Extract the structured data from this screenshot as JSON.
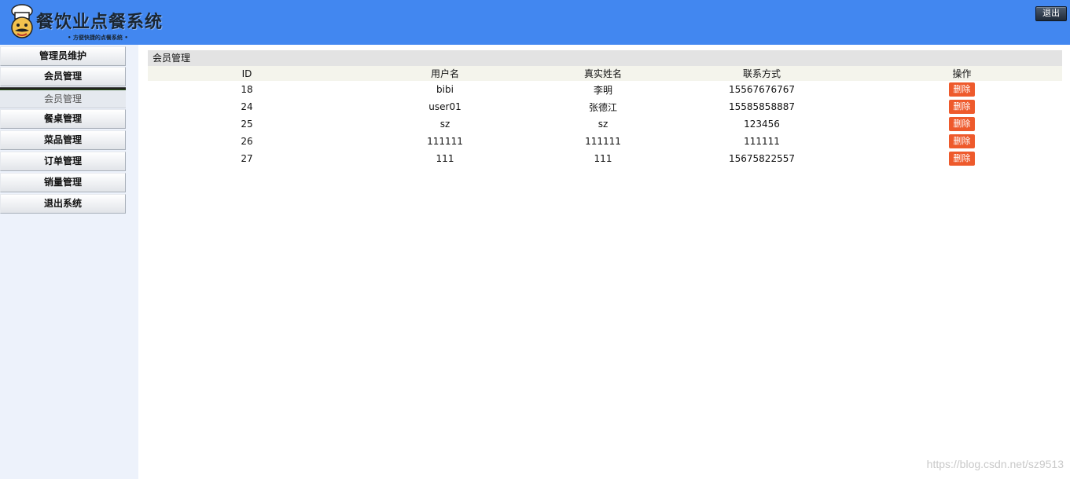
{
  "header": {
    "title": "餐饮业点餐系统",
    "slogan": "• 方便快捷的点餐系统 •",
    "logout_label": "退出",
    "background": "#4287f0"
  },
  "sidebar": {
    "menus": [
      {
        "label": "管理员维护"
      },
      {
        "label": "会员管理"
      },
      {
        "label": "餐桌管理"
      },
      {
        "label": "菜品管理"
      },
      {
        "label": "订单管理"
      },
      {
        "label": "销量管理"
      },
      {
        "label": "退出系统"
      }
    ],
    "submenu": {
      "label": "会员管理"
    }
  },
  "main": {
    "panel_title": "会员管理",
    "columns": [
      "ID",
      "用户名",
      "真实姓名",
      "联系方式",
      "操作"
    ],
    "delete_label": "删除",
    "rows": [
      {
        "id": "18",
        "username": "bibi",
        "realname": "李明",
        "phone": "15567676767"
      },
      {
        "id": "24",
        "username": "user01",
        "realname": "张德江",
        "phone": "15585858887"
      },
      {
        "id": "25",
        "username": "sz",
        "realname": "sz",
        "phone": "123456"
      },
      {
        "id": "26",
        "username": "111111",
        "realname": "111111",
        "phone": "111111"
      },
      {
        "id": "27",
        "username": "111",
        "realname": "111",
        "phone": "15675822557"
      }
    ]
  },
  "watermark": "https://blog.csdn.net/sz9513"
}
